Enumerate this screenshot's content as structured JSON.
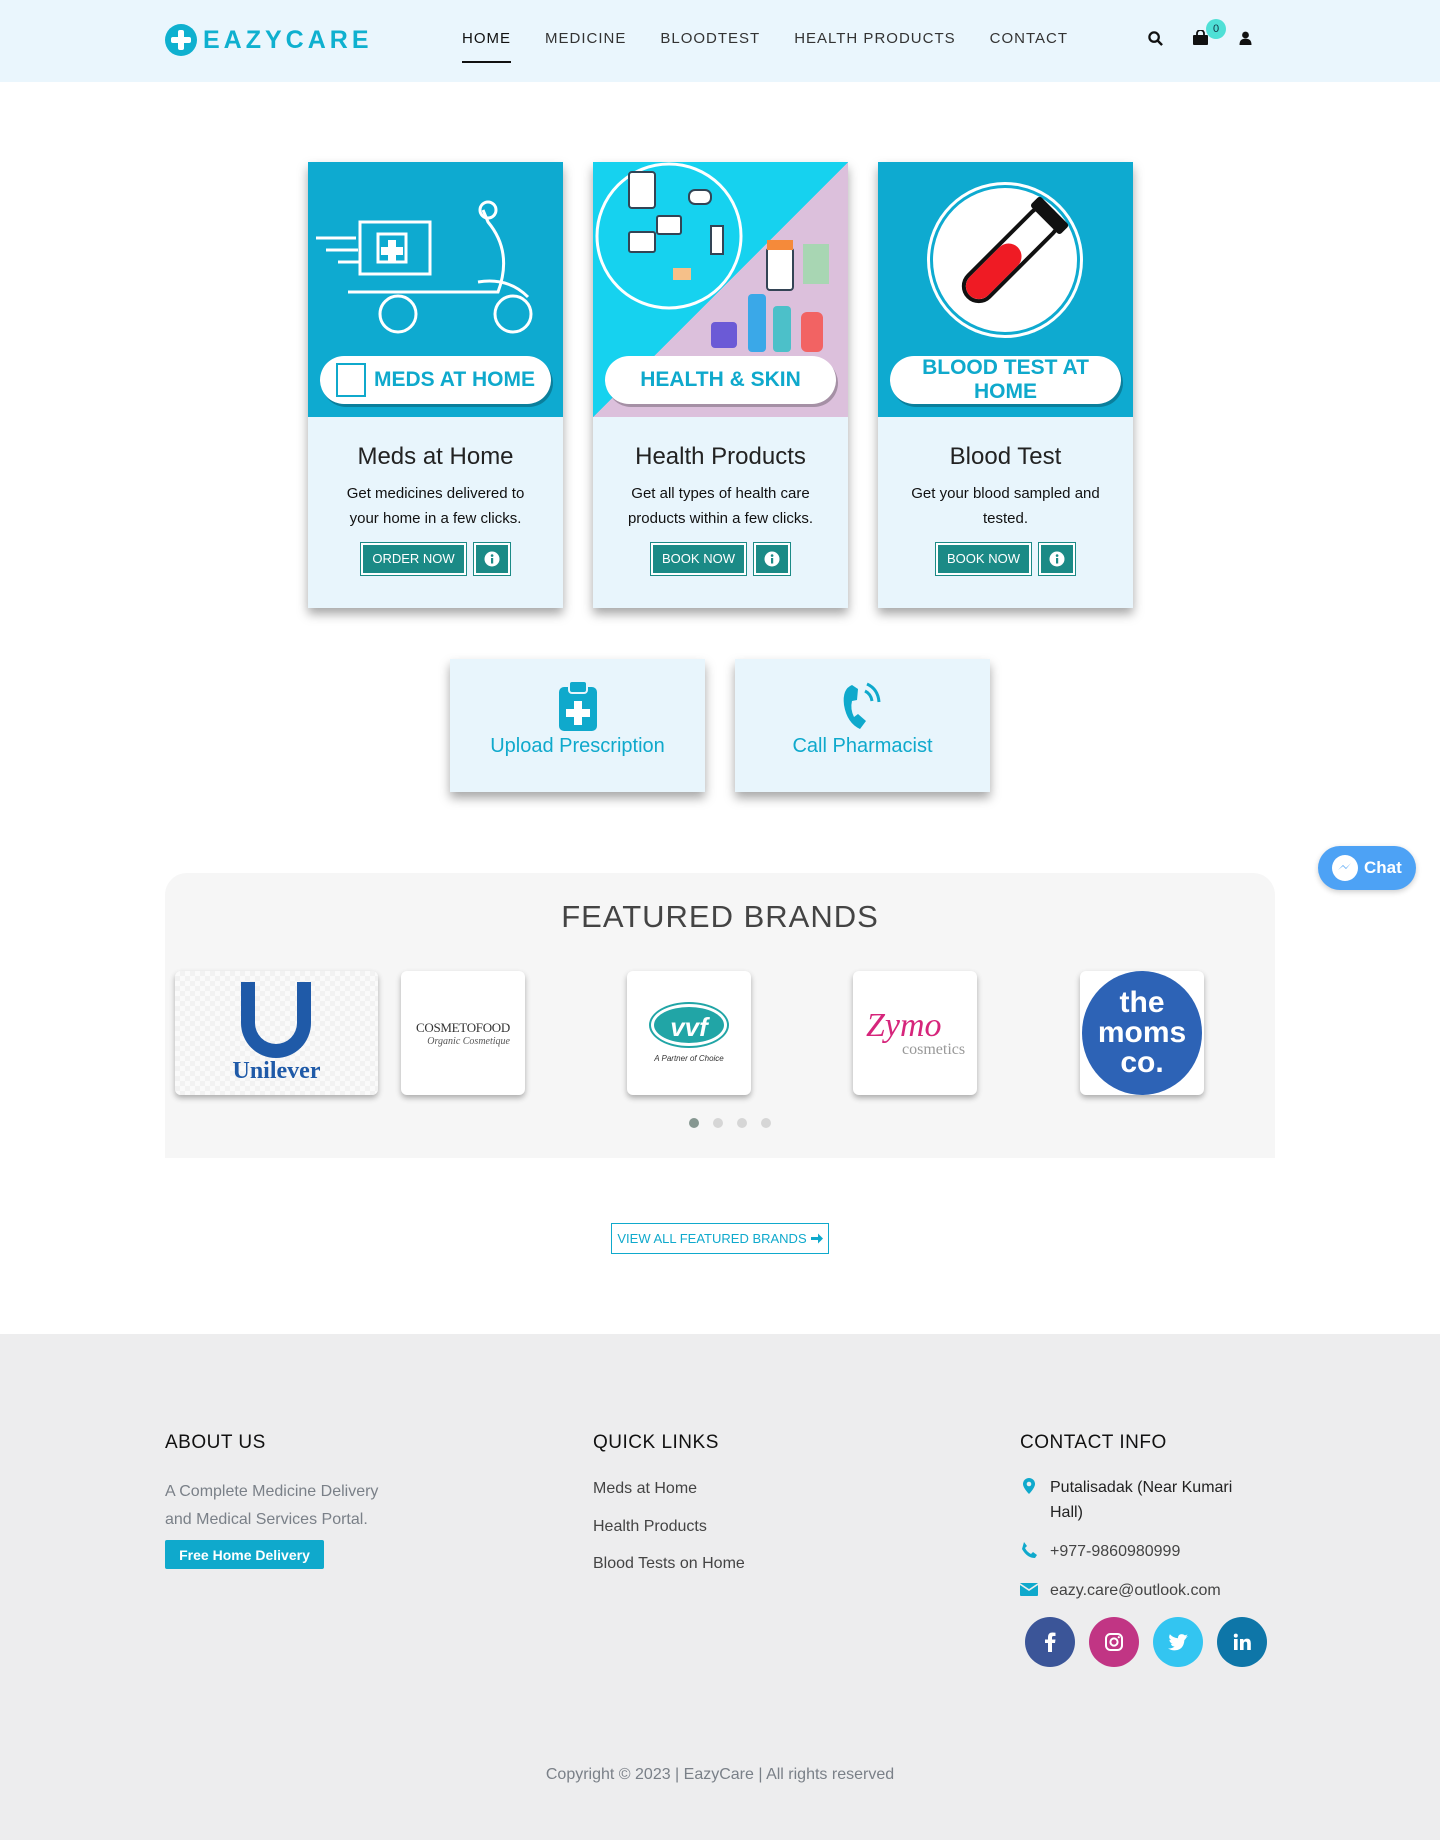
{
  "header": {
    "brand": "EAZYCARE",
    "nav": [
      "HOME",
      "MEDICINE",
      "BLOODTEST",
      "HEALTH PRODUCTS",
      "CONTACT"
    ],
    "active_nav": "HOME",
    "cart_count": "0",
    "icons": [
      "search-icon",
      "cart-icon",
      "user-icon"
    ]
  },
  "services": [
    {
      "image_label": "MEDS AT HOME",
      "title": "Meds at Home",
      "desc": "Get medicines delivered to your home in a few clicks.",
      "button": "ORDER NOW"
    },
    {
      "image_label": "HEALTH & SKIN",
      "title": "Health Products",
      "desc": "Get all types of health care products within a few clicks.",
      "button": "BOOK NOW"
    },
    {
      "image_label": "BLOOD TEST AT HOME",
      "title": "Blood Test",
      "desc": "Get your blood sampled and tested.",
      "button": "BOOK NOW"
    }
  ],
  "quick_actions": [
    {
      "label": "Upload Prescription",
      "icon": "prescription-icon"
    },
    {
      "label": "Call Pharmacist",
      "icon": "phone-call-icon"
    }
  ],
  "chat": {
    "label": "Chat"
  },
  "brands": {
    "title": "FEATURED BRANDS",
    "items": [
      {
        "name": "Unilever",
        "logo_text": "Unilever"
      },
      {
        "name": "Cosmetofood",
        "logo_text": "COSMETOFOOD",
        "tagline": "Organic Cosmetique"
      },
      {
        "name": "VVF",
        "logo_text": "vvf",
        "tagline": "A Partner of Choice"
      },
      {
        "name": "Zymo Cosmetics",
        "logo_text": "Zymo",
        "tagline": "cosmetics"
      },
      {
        "name": "The Moms Co.",
        "logo_text": "the moms co."
      }
    ],
    "dots": 4,
    "active_dot": 0,
    "view_all": "VIEW ALL FEATURED BRANDS"
  },
  "footer": {
    "about_title": "ABOUT US",
    "about_text": "A Complete Medicine Delivery and Medical Services Portal.",
    "free_delivery": "Free Home Delivery",
    "links_title": "QUICK LINKS",
    "links": [
      "Meds at Home",
      "Health Products",
      "Blood Tests on Home"
    ],
    "contact_title": "CONTACT INFO",
    "address": "Putalisadak (Near Kumari Hall)",
    "phone": "+977-9860980999",
    "email": "eazy.care@outlook.com",
    "socials": [
      {
        "name": "facebook",
        "color": "#3b5598"
      },
      {
        "name": "instagram",
        "color": "#c13584"
      },
      {
        "name": "twitter",
        "color": "#33c5f1"
      },
      {
        "name": "linkedin",
        "color": "#0e76a8"
      }
    ],
    "copyright": "Copyright © 2023 | EazyCare | All rights reserved"
  },
  "colors": {
    "accent": "#0fa9cc",
    "button": "#1b8a86",
    "header_bg": "#eaf6fd",
    "card_bg": "#e8f5fc",
    "footer_bg": "#ededee"
  }
}
